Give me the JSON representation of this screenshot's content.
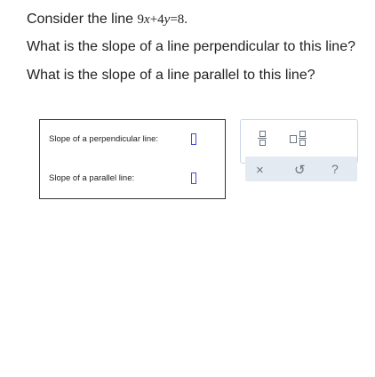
{
  "question": {
    "line1_prefix": "Consider the line ",
    "equation": {
      "c1": "9",
      "v1": "x",
      "op": "+",
      "c2": "4",
      "v2": "y",
      "eq": "=",
      "rhs": "8",
      "end": "."
    },
    "line2": "What is the slope of a line perpendicular to this line?",
    "line3": "What is the slope of a line parallel to this line?"
  },
  "answers": {
    "perpendicular_label": "Slope of a perpendicular line:",
    "perpendicular_value": "",
    "parallel_label": "Slope of a parallel line:",
    "parallel_value": ""
  },
  "toolbar": {
    "fraction_icon": "fraction-icon",
    "mixed_number_icon": "mixed-number-icon",
    "clear_symbol": "×",
    "undo_symbol": "↺",
    "help_symbol": "?",
    "input_border_color": "#4a4ad6",
    "icon_color": "#6a7580",
    "row_background": "#e4eaf1"
  }
}
